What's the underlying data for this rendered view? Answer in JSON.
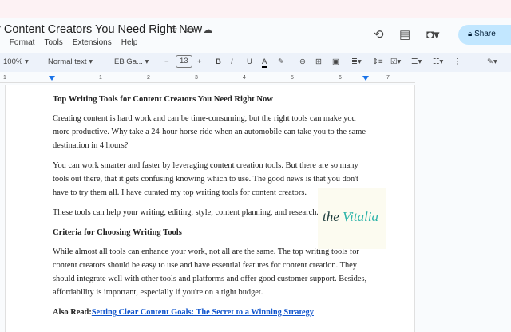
{
  "header": {
    "title": "r Content Creators You Need Right Now",
    "share_label": "Share",
    "menu": [
      "t",
      "Format",
      "Tools",
      "Extensions",
      "Help"
    ]
  },
  "toolbar": {
    "zoom": "100%",
    "style": "Normal text",
    "font": "EB Ga...",
    "font_size": "13"
  },
  "ruler": [
    "1",
    "1",
    "2",
    "3",
    "4",
    "5",
    "6",
    "7"
  ],
  "document": {
    "heading1": "Top Writing Tools for Content Creators You Need Right Now",
    "p1": "Creating content is hard work and can be time-consuming, but the right tools can make you more productive. Why take a 24-hour horse ride when an automobile can take you to the same destination in 4 hours?",
    "p2": "You can work smarter and faster by leveraging content creation tools. But there are so many tools out there, that it gets confusing knowing which to use. The good news is that you don't have to try them all. I have curated my top writing tools for content creators.",
    "p3": "These tools can help your writing, editing, style, content planning, and research.",
    "heading2": "Criteria for Choosing Writing Tools",
    "p4": "While almost all tools can enhance your work, not all are the same. The top writing tools for content creators should be easy to use and have essential features for content creation. They should integrate well with other tools and platforms and offer good customer support. Besides, affordability is important, especially if you're on a tight budget.",
    "also_read_label": "Also Read:",
    "also_read_link": "Setting Clear Content Goals: The Secret to a Winning Strategy"
  },
  "logo": {
    "text": "the Vitalia"
  },
  "colors": {
    "share_bg": "#c2e7ff",
    "toolbar_bg": "#edf2fa",
    "link": "#1155cc"
  }
}
